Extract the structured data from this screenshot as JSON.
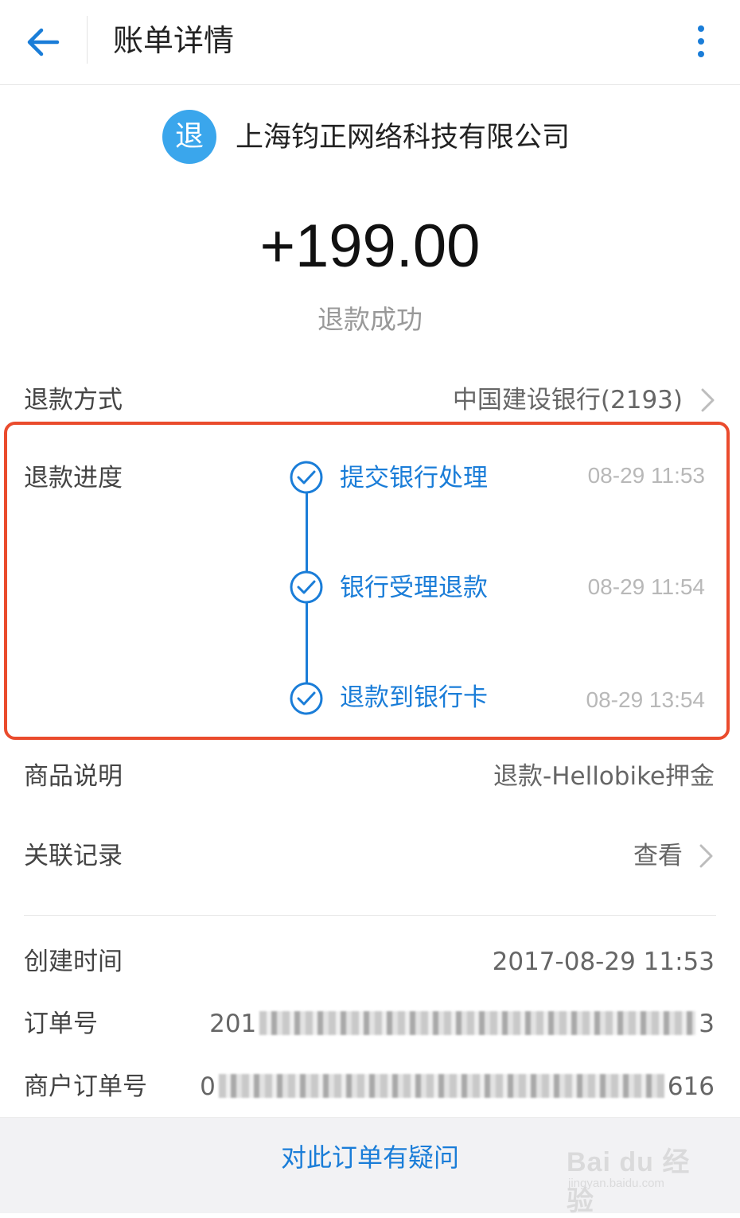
{
  "header": {
    "title": "账单详情",
    "back_icon": "arrow-left-icon",
    "more_icon": "more-vertical-icon",
    "accent": "#1a7dd8"
  },
  "merchant": {
    "badge": "退",
    "name": "上海钧正网络科技有限公司",
    "badge_color": "#3aa6ec"
  },
  "amount": "+199.00",
  "status": "退款成功",
  "refund_method": {
    "label": "退款方式",
    "value": "中国建设银行(2193)"
  },
  "progress": {
    "label": "退款进度",
    "highlight_color": "#ea4b2d",
    "steps": [
      {
        "label": "提交银行处理",
        "time": "08-29 11:53"
      },
      {
        "label": "银行受理退款",
        "time": "08-29 11:54"
      },
      {
        "label": "退款到银行卡",
        "time": "08-29 13:54"
      }
    ]
  },
  "product": {
    "label": "商品说明",
    "value": "退款-Hellobike押金"
  },
  "related": {
    "label": "关联记录",
    "value": "查看"
  },
  "created": {
    "label": "创建时间",
    "value": "2017-08-29 11:53"
  },
  "order_no": {
    "label": "订单号",
    "prefix": "201",
    "suffix": "3"
  },
  "merchant_order_no": {
    "label": "商户订单号",
    "prefix": "0",
    "suffix": "616"
  },
  "footer": {
    "question_label": "对此订单有疑问",
    "watermark": "Bai du 经验",
    "watermark_sub": "jingyan.baidu.com"
  }
}
